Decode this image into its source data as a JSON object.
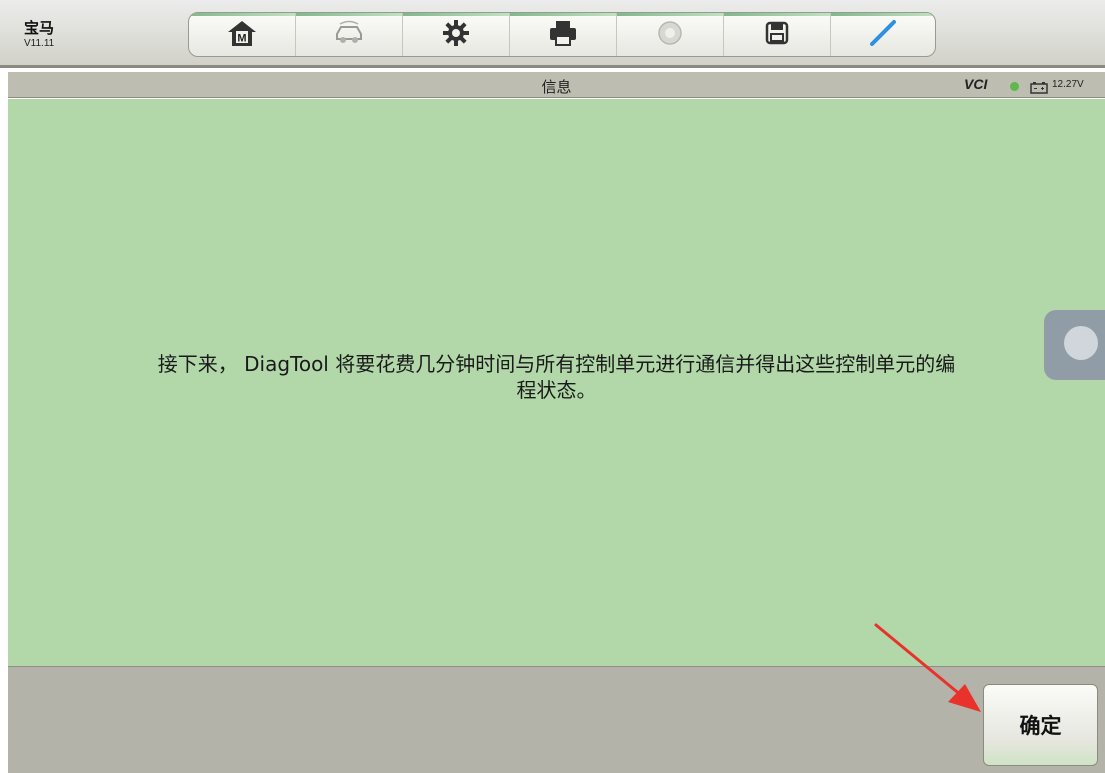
{
  "app": {
    "name": "宝马",
    "version": "V11.11"
  },
  "toolbar": {
    "buttons": [
      {
        "icon": "home-icon",
        "label": "M"
      },
      {
        "icon": "vehicle-icon"
      },
      {
        "icon": "gear-icon"
      },
      {
        "icon": "printer-icon"
      },
      {
        "icon": "help-icon"
      },
      {
        "icon": "save-icon"
      },
      {
        "icon": "pen-icon"
      }
    ]
  },
  "status": {
    "title": "信息",
    "vci": "VCI",
    "battery": "12.27V"
  },
  "message": {
    "line1": "接下来， DiagTool 将要花费几分钟时间与所有控制单元进行通信并得出这些控制单元的编",
    "line2": "程状态。"
  },
  "footer": {
    "ok_label": "确定"
  },
  "colors": {
    "content_bg": "#b2d8aa",
    "footer_bg": "#b3b3a9",
    "status_bg": "#bdbdb1",
    "arrow": "#e8322b"
  }
}
